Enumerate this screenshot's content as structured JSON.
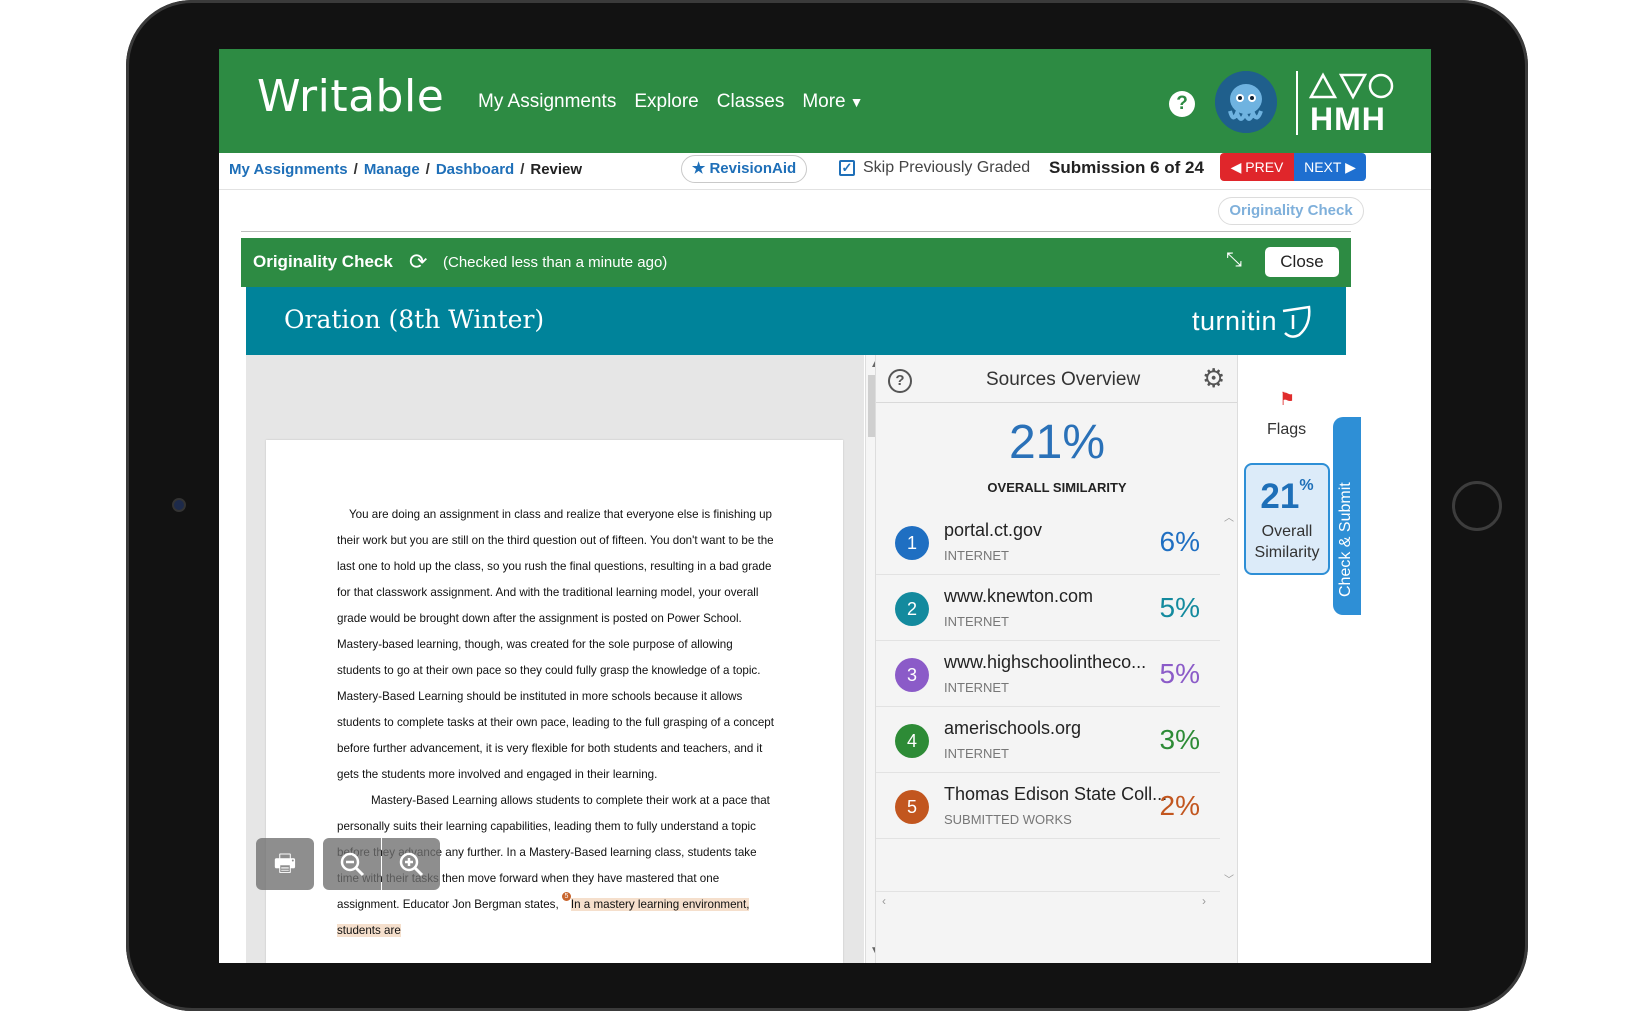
{
  "app": {
    "logo": "Writable",
    "nav": [
      "My Assignments",
      "Explore",
      "Classes",
      "More"
    ],
    "publisher": "HMH"
  },
  "breadcrumb": [
    "My Assignments",
    "Manage",
    "Dashboard",
    "Review"
  ],
  "toolbar": {
    "revision_aid": "RevisionAid",
    "skip_label": "Skip Previously Graded",
    "skip_checked": true,
    "submission": "Submission 6 of 24",
    "prev": "PREV",
    "next": "NEXT",
    "originality_tab": "Originality Check"
  },
  "originality": {
    "title": "Originality Check",
    "status": "(Checked less than a minute ago)",
    "close": "Close"
  },
  "turnitin": {
    "doc_title": "Oration (8th Winter)",
    "brand": "turnitin"
  },
  "document": {
    "p1": "You are doing an assignment in class and realize that everyone else is finishing up their work but you are still on the third question out of fifteen. You don't want to be the last one to hold up the class, so you rush the final questions, resulting in a bad grade for that classwork assignment. And with the traditional learning model, your overall grade would be brought down after the assignment is posted on Power School. Mastery-based learning, though, was created for the sole purpose of allowing students to go at their own pace so they could fully grasp the knowledge of a topic. Mastery-Based Learning should be instituted in more schools because it allows students to complete tasks at their own pace, leading to the full grasping of a concept before further advancement, it is very flexible for both students and teachers, and it gets the students more involved and engaged in their learning.",
    "p2_a": "Mastery-Based Learning allows students to complete their work at a pace that personally suits their learning capabilities, leading them to fully understand a topic before they advance any further. In a Mastery-Based learning class, students take time with their tasks then move forward when they have mastered that one assignment. Educator Jon Bergman states, ",
    "p2_marker": "5",
    "p2_b": "In a mastery learning environment, students are"
  },
  "sources": {
    "title": "Sources Overview",
    "overall_pct": "21%",
    "overall_label": "OVERALL SIMILARITY",
    "items": [
      {
        "num": "1",
        "name": "portal.ct.gov",
        "type": "INTERNET",
        "pct": "6%",
        "color": "#1f6fc2"
      },
      {
        "num": "2",
        "name": "www.knewton.com",
        "type": "INTERNET",
        "pct": "5%",
        "color": "#138a9e"
      },
      {
        "num": "3",
        "name": "www.highschoolintheco...",
        "type": "INTERNET",
        "pct": "5%",
        "color": "#8b5bc8"
      },
      {
        "num": "4",
        "name": "amerischools.org",
        "type": "INTERNET",
        "pct": "3%",
        "color": "#2d8b36"
      },
      {
        "num": "5",
        "name": "Thomas Edison State Coll...",
        "type": "SUBMITTED WORKS",
        "pct": "2%",
        "color": "#c2561f"
      }
    ]
  },
  "rail": {
    "flags": "Flags",
    "sim_number": "21",
    "sim_unit": "%",
    "sim_label": "Overall Similarity",
    "check_submit": "Check & Submit"
  }
}
